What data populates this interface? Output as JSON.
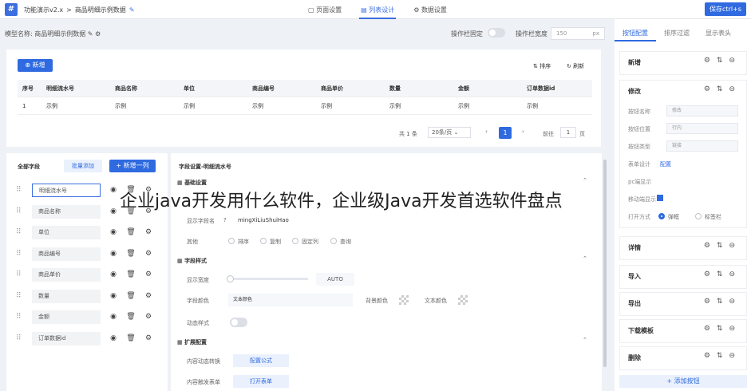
{
  "header": {
    "logo": "#",
    "app_name": "功能演示v2.x",
    "sep": ">",
    "page": "商品明细示例数据",
    "tabs": [
      "页面设置",
      "列表设计",
      "数据设置"
    ],
    "active_tab": 1,
    "save": "保存ctrl+s"
  },
  "model": {
    "label": "模型名称:",
    "name": "商品明细示例数据",
    "fix_label": "操作栏固定",
    "width_label": "操作栏宽度",
    "width_value": "150",
    "width_unit": "px"
  },
  "list": {
    "add": "新增",
    "sort": "排序",
    "refresh": "刷新",
    "columns": [
      "序号",
      "明细流水号",
      "商品名称",
      "单位",
      "商品编号",
      "商品单价",
      "数量",
      "金额",
      "订单数据id"
    ],
    "row": [
      "1",
      "示例",
      "示例",
      "示例",
      "示例",
      "示例",
      "示例",
      "示例",
      "示例"
    ],
    "total": "共 1 条",
    "page_size": "20条/页",
    "page": "1",
    "goto": "前往",
    "goto_page": "1",
    "page_unit": "页"
  },
  "fields": {
    "title": "全部字段",
    "batch_add": "批量添加",
    "add_col": "+ 新增一列",
    "items": [
      "明细流水号",
      "商品名称",
      "单位",
      "商品编号",
      "商品单价",
      "数量",
      "金额",
      "订单数据id"
    ]
  },
  "settings": {
    "title": "字段设置-明细流水号",
    "basic": "基础设置",
    "display_name_label": "显示字段名",
    "display_name": "mingXiLiuShuiHao",
    "other_label": "其他",
    "other_opts": [
      "排序",
      "复制",
      "固定列",
      "查询"
    ],
    "style": "字段样式",
    "width_label": "显示宽度",
    "width_value": "AUTO",
    "color_label": "字段颜色",
    "color_value": "文本颜色",
    "bg_label": "背景颜色",
    "text_color_label": "文本颜色",
    "dyn_label": "动态样式",
    "ext": "扩展配置",
    "conv_label": "内容动态转换",
    "conv_btn": "配置公式",
    "trig_label": "内容触发表单",
    "trig_btn": "打开表单"
  },
  "right": {
    "tabs": [
      "按钮配置",
      "排序过滤",
      "显示表头"
    ],
    "cards": [
      "新增",
      "修改",
      "详情",
      "导入",
      "导出",
      "下载模板",
      "删除"
    ],
    "edit_form": {
      "name_label": "按钮名称",
      "name_value": "修改",
      "pos_label": "按钮位置",
      "pos_value": "行内",
      "type_label": "按钮类型",
      "type_value": "链接",
      "form_label": "表单设计",
      "form_link": "配置",
      "pc_label": "pc端显示",
      "mobile_label": "移动端显示",
      "open_label": "打开方式",
      "open_opts": [
        "弹框",
        "标签栏"
      ]
    },
    "add_btn": "+ 添加按钮"
  },
  "overlay": "企业java开发用什么软件，企业级Java开发首选软件盘点"
}
